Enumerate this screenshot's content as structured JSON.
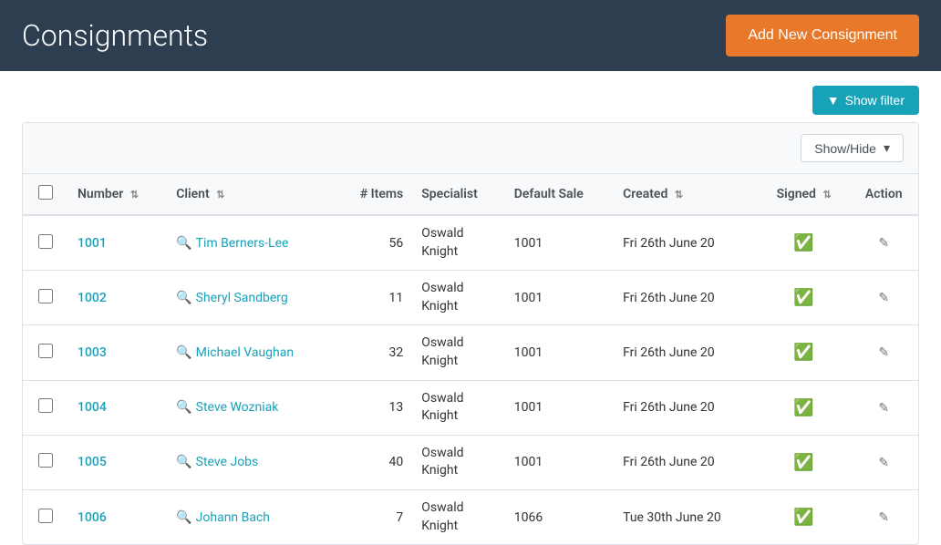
{
  "header": {
    "title": "Consignments",
    "add_button_label": "Add New Consignment"
  },
  "toolbar": {
    "show_filter_label": "Show filter"
  },
  "table_toolbar": {
    "show_hide_label": "Show/Hide"
  },
  "table": {
    "columns": [
      {
        "key": "checkbox",
        "label": ""
      },
      {
        "key": "number",
        "label": "Number",
        "sortable": true
      },
      {
        "key": "client",
        "label": "Client",
        "sortable": true
      },
      {
        "key": "items",
        "label": "# Items",
        "sortable": false
      },
      {
        "key": "specialist",
        "label": "Specialist",
        "sortable": false
      },
      {
        "key": "default_sale",
        "label": "Default Sale",
        "sortable": false
      },
      {
        "key": "created",
        "label": "Created",
        "sortable": true
      },
      {
        "key": "signed",
        "label": "Signed",
        "sortable": true
      },
      {
        "key": "action",
        "label": "Action",
        "sortable": false
      }
    ],
    "rows": [
      {
        "number": "1001",
        "client": "Tim Berners-Lee",
        "items": "56",
        "specialist": "Oswald Knight",
        "default_sale": "1001",
        "created": "Fri 26th June 20",
        "signed": true
      },
      {
        "number": "1002",
        "client": "Sheryl Sandberg",
        "items": "11",
        "specialist": "Oswald Knight",
        "default_sale": "1001",
        "created": "Fri 26th June 20",
        "signed": true
      },
      {
        "number": "1003",
        "client": "Michael Vaughan",
        "items": "32",
        "specialist": "Oswald Knight",
        "default_sale": "1001",
        "created": "Fri 26th June 20",
        "signed": true
      },
      {
        "number": "1004",
        "client": "Steve Wozniak",
        "items": "13",
        "specialist": "Oswald Knight",
        "default_sale": "1001",
        "created": "Fri 26th June 20",
        "signed": true
      },
      {
        "number": "1005",
        "client": "Steve Jobs",
        "items": "40",
        "specialist": "Oswald Knight",
        "default_sale": "1001",
        "created": "Fri 26th June 20",
        "signed": true
      },
      {
        "number": "1006",
        "client": "Johann Bach",
        "items": "7",
        "specialist": "Oswald Knight",
        "default_sale": "1066",
        "created": "Tue 30th June 20",
        "signed": true
      }
    ]
  },
  "icons": {
    "filter": "▼",
    "sort": "⇅",
    "chevron_down": "▾",
    "signed": "✔",
    "edit": "✏",
    "client_search": "🔍"
  }
}
